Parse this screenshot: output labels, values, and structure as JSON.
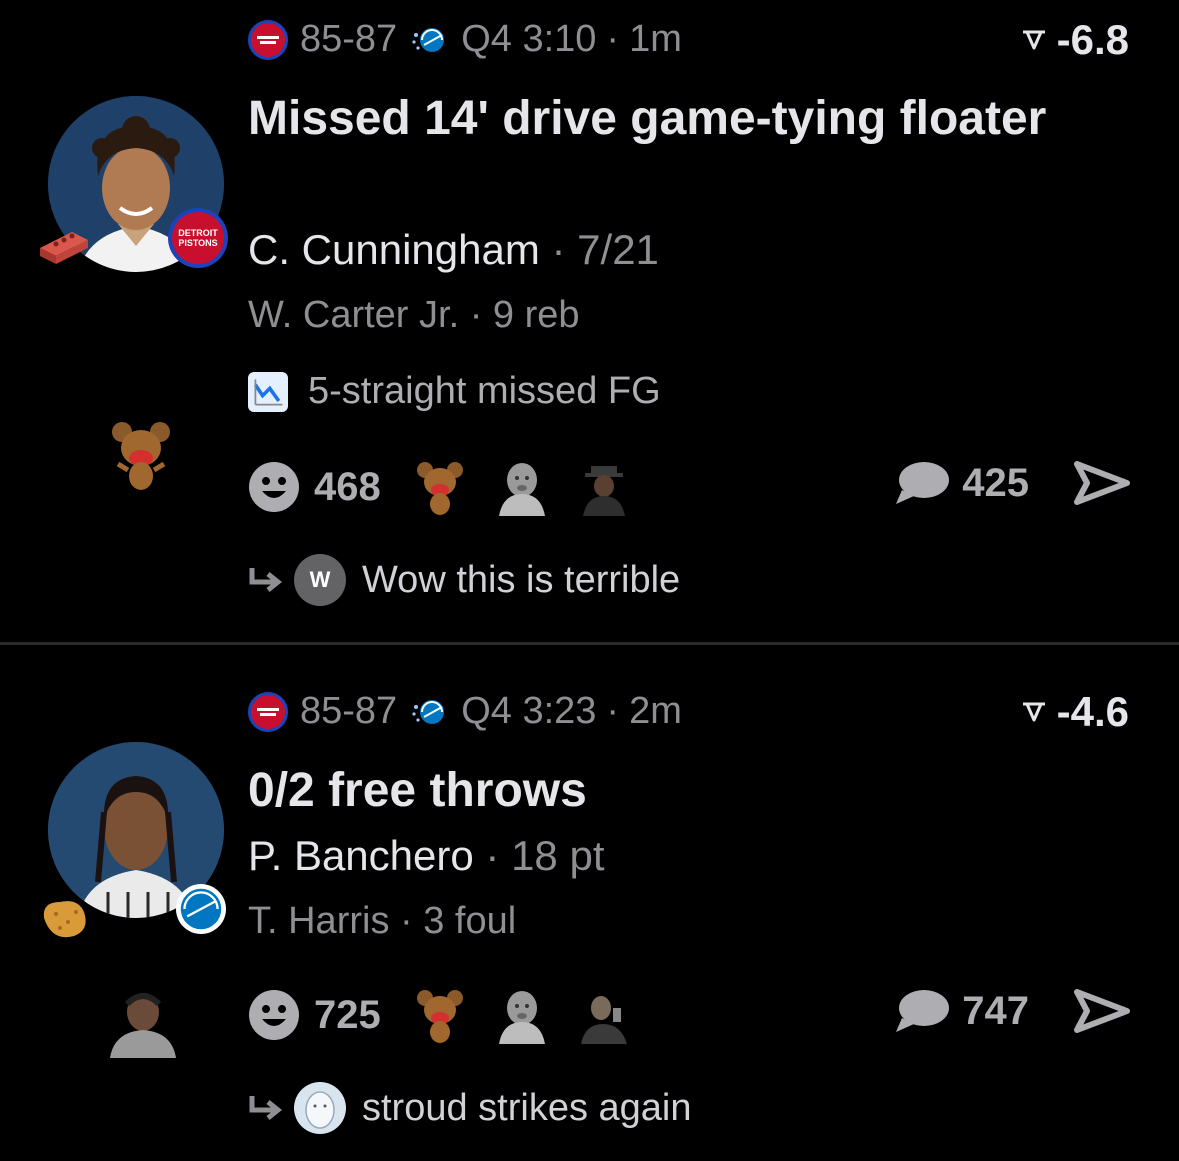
{
  "feed": [
    {
      "score": "85-87",
      "clock": "Q4 3:10",
      "age": "1m",
      "delta": "-6.8",
      "title": "Missed 14' drive game-tying floater",
      "player": "C. Cunningham",
      "player_stat": "7/21",
      "secondary": "W. Carter Jr.",
      "secondary_stat": "9 reb",
      "streak": "5-straight missed FG",
      "reaction_count": "468",
      "comment_count": "425",
      "reply_avatar_letter": "W",
      "reply_text": "Wow this is terrible",
      "team_badge": "DETROIT PISTONS"
    },
    {
      "score": "85-87",
      "clock": "Q4 3:23",
      "age": "2m",
      "delta": "-4.6",
      "title": "0/2 free throws",
      "player": "P. Banchero",
      "player_stat": "18 pt",
      "secondary": "T. Harris",
      "secondary_stat": "3 foul",
      "reaction_count": "725",
      "comment_count": "747",
      "reply_text": "stroud strikes again"
    }
  ],
  "separator": "·",
  "icons": {
    "team_left": "pistons-logo-icon",
    "team_right": "magic-logo-icon",
    "delta": "trend-arrow-icon",
    "streak": "chart-down-icon",
    "reactions": "smiley-icon",
    "comments": "speech-bubble-icon",
    "share": "send-icon",
    "reply": "reply-arrow-icon",
    "badge1": "brick-icon",
    "badge2": "nugget-icon"
  },
  "colors": {
    "background": "#000000",
    "primary_text": "#e5e5ea",
    "secondary_text": "#8e8e93",
    "pistons_red": "#c8102e",
    "magic_blue": "#0077c0"
  }
}
